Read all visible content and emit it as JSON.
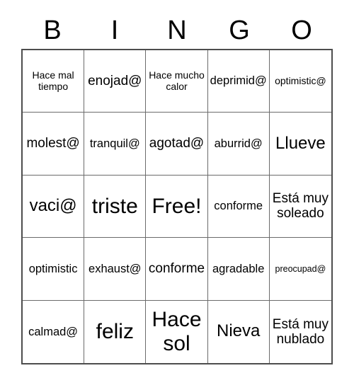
{
  "card": {
    "headers": [
      "B",
      "I",
      "N",
      "G",
      "O"
    ],
    "rows": [
      [
        {
          "text": "Hace mal tiempo",
          "size": "sm"
        },
        {
          "text": "enojad@",
          "size": "lg"
        },
        {
          "text": "Hace mucho calor",
          "size": "sm"
        },
        {
          "text": "deprimid@",
          "size": "md"
        },
        {
          "text": "optimistic@",
          "size": "sm"
        }
      ],
      [
        {
          "text": "molest@",
          "size": "lg"
        },
        {
          "text": "tranquil@",
          "size": "md"
        },
        {
          "text": "agotad@",
          "size": "lg"
        },
        {
          "text": "aburrid@",
          "size": "md"
        },
        {
          "text": "Llueve",
          "size": "xl"
        }
      ],
      [
        {
          "text": "vaci@",
          "size": "xl"
        },
        {
          "text": "triste",
          "size": "xxl"
        },
        {
          "text": "Free!",
          "size": "xxl"
        },
        {
          "text": "conforme",
          "size": "md"
        },
        {
          "text": "Está muy soleado",
          "size": "lg"
        }
      ],
      [
        {
          "text": "optimistic",
          "size": "md"
        },
        {
          "text": "exhaust@",
          "size": "md"
        },
        {
          "text": "conforme",
          "size": "lg"
        },
        {
          "text": "agradable",
          "size": "md"
        },
        {
          "text": "preocupad@",
          "size": "xs"
        }
      ],
      [
        {
          "text": "calmad@",
          "size": "md"
        },
        {
          "text": "feliz",
          "size": "xxl"
        },
        {
          "text": "Hace sol",
          "size": "xxl"
        },
        {
          "text": "Nieva",
          "size": "xl"
        },
        {
          "text": "Está muy nublado",
          "size": "lg"
        }
      ]
    ]
  },
  "colors": {
    "background": "#ffffff",
    "text": "#000000",
    "grid_outer_border": "#4d4d4d",
    "grid_inner_line": "#6b6b6b"
  }
}
